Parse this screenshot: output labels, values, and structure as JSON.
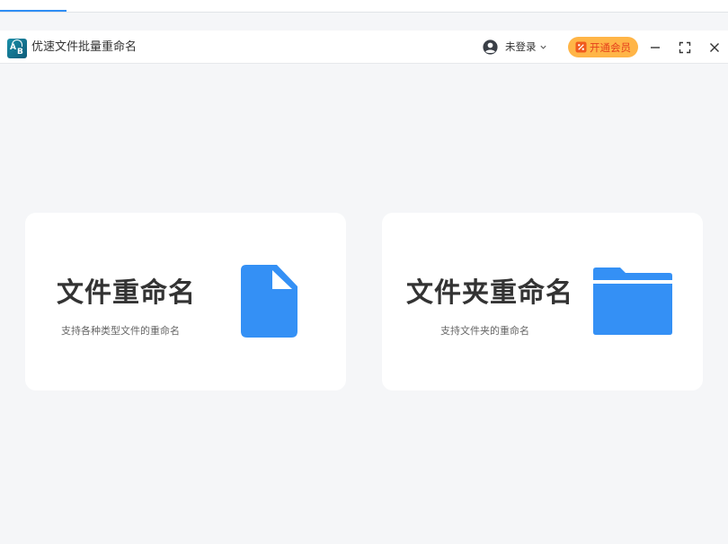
{
  "app": {
    "title": "优速文件批量重命名"
  },
  "header": {
    "user_label": "未登录",
    "vip_label": "开通会员"
  },
  "cards": [
    {
      "title": "文件重命名",
      "description": "支持各种类型文件的重命名",
      "icon": "file-icon"
    },
    {
      "title": "文件夹重命名",
      "description": "支持文件夹的重命名",
      "icon": "folder-icon"
    }
  ],
  "colors": {
    "accent": "#2f8ef4",
    "icon_blue": "#3490f5",
    "vip_bg": "#ffb547",
    "vip_text": "#e5411c",
    "background": "#f5f6f8"
  }
}
